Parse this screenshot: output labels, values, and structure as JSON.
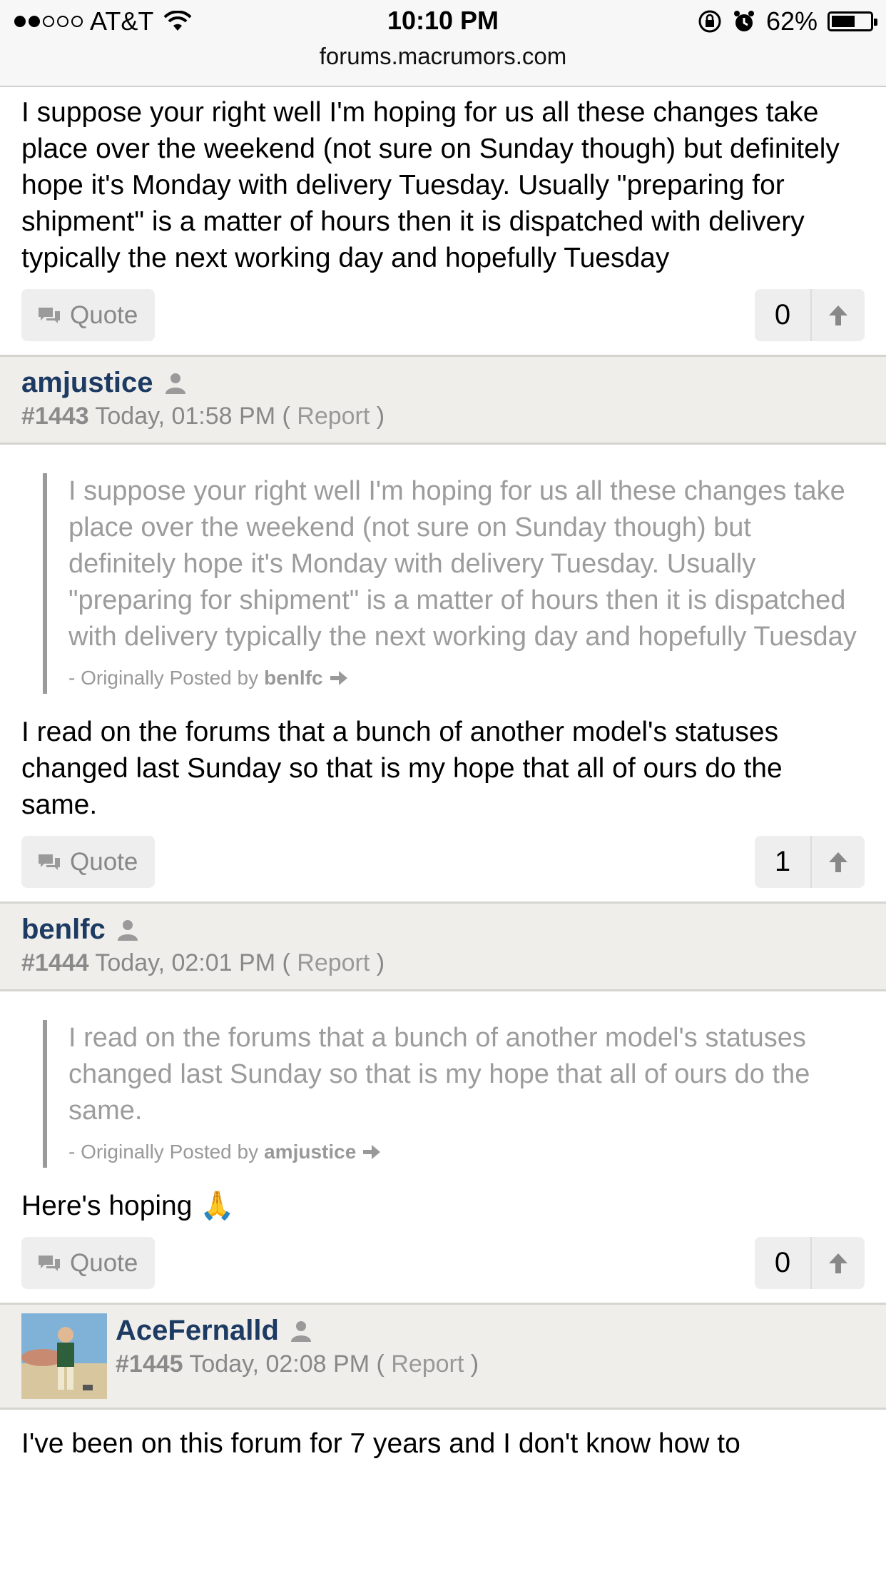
{
  "status_bar": {
    "carrier": "AT&T",
    "time": "10:10 PM",
    "battery_percent": "62%",
    "battery_level": 0.62,
    "url": "forums.macrumors.com"
  },
  "top_post": {
    "body": "I suppose your right well I'm hoping for us all these changes take place over the weekend (not sure on Sunday though) but definitely hope it's Monday with delivery Tuesday. Usually \"preparing for shipment\" is a matter of hours then it is dispatched with delivery typically the next working day and hopefully Tuesday",
    "quote_label": "Quote",
    "likes": "0"
  },
  "posts": [
    {
      "author": "amjustice",
      "number": "#1443",
      "time": "Today, 01:58 PM",
      "report_open": "(",
      "report_label": "Report",
      "report_close": ")",
      "quote_text": "I suppose your right well I'm hoping for us all these changes take place over the weekend (not sure on Sunday though) but definitely hope it's Monday with delivery Tuesday. Usually \"preparing for shipment\" is a matter of hours then it is dispatched with delivery typically the next working day and hopefully Tuesday",
      "quote_prefix": "- Originally Posted by",
      "quote_author": "benlfc",
      "body": "I read on the forums that a bunch of another model's statuses changed last Sunday so that is my hope that all of ours do the same.",
      "quote_label": "Quote",
      "likes": "1"
    },
    {
      "author": "benlfc",
      "number": "#1444",
      "time": "Today, 02:01 PM",
      "report_open": "(",
      "report_label": "Report",
      "report_close": ")",
      "quote_text": "I read on the forums that a bunch of another model's statuses changed last Sunday so that is my hope that all of ours do the same.",
      "quote_prefix": "- Originally Posted by",
      "quote_author": "amjustice",
      "body": "Here's hoping 🙏",
      "quote_label": "Quote",
      "likes": "0"
    },
    {
      "author": "AceFernalld",
      "number": "#1445",
      "time": "Today, 02:08 PM",
      "report_open": "(",
      "report_label": "Report",
      "report_close": ")",
      "body": "I've been on this forum for 7 years and I don't know how to"
    }
  ]
}
